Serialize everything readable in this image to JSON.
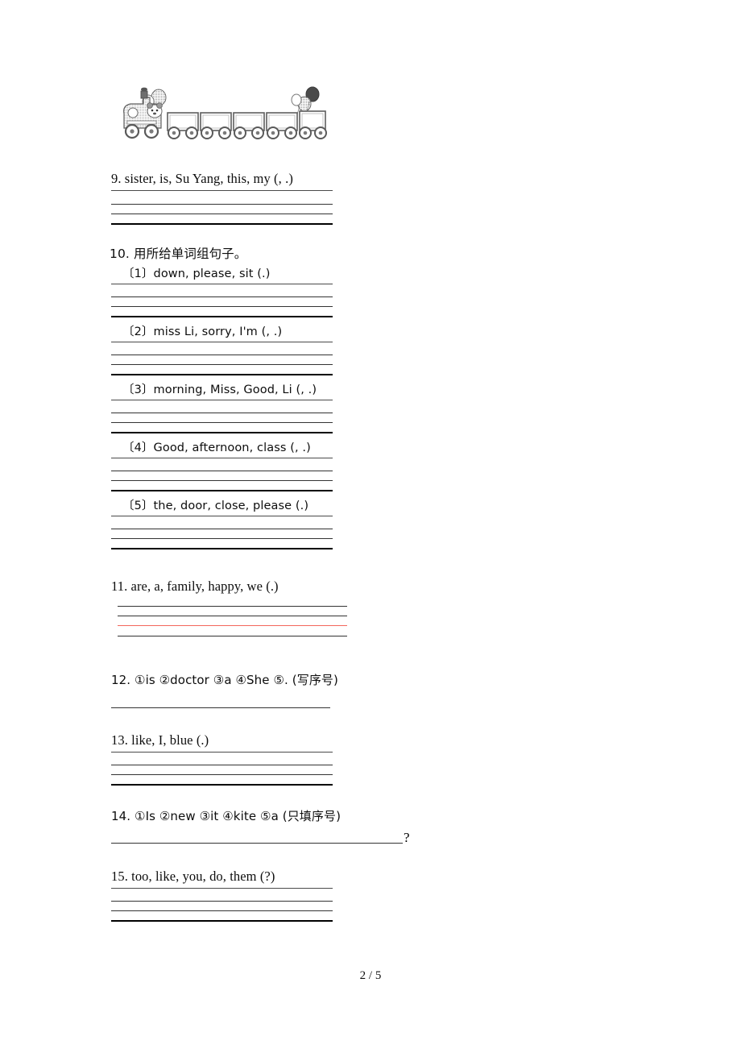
{
  "document": {
    "page_label": "2 / 5",
    "illustration": "train-clipart"
  },
  "questions": [
    {
      "id": "q9",
      "number": "9.",
      "prompt": "9. sister, is, Su Yang, this, my (, .)",
      "answer_lines": 4
    },
    {
      "id": "q10",
      "number": "10.",
      "prompt": "10. 用所给单词组句子。",
      "sub_items": [
        {
          "id": "q10-1",
          "label": "〔1〕",
          "prompt": "〔1〕down, please, sit (.)"
        },
        {
          "id": "q10-2",
          "label": "〔2〕",
          "prompt": "〔2〕miss Li, sorry, I'm (, .)"
        },
        {
          "id": "q10-3",
          "label": "〔3〕",
          "prompt": "〔3〕morning, Miss, Good, Li (, .)"
        },
        {
          "id": "q10-4",
          "label": "〔4〕",
          "prompt": "〔4〕Good, afternoon, class (, .)"
        },
        {
          "id": "q10-5",
          "label": "〔5〕",
          "prompt": "〔5〕the, door, close, please (.)"
        }
      ]
    },
    {
      "id": "q11",
      "number": "11.",
      "prompt": "11. are, a, family, happy, we (.)",
      "answer_lines": 4,
      "highlight_color": "#f4675c"
    },
    {
      "id": "q12",
      "number": "12.",
      "prompt": "12. ①is  ②doctor  ③a  ④She  ⑤. (写序号)",
      "answer_lines": 1
    },
    {
      "id": "q13",
      "number": "13.",
      "prompt": "13. like, I, blue (.)",
      "answer_lines": 4
    },
    {
      "id": "q14",
      "number": "14.",
      "prompt": "14. ①Is  ②new ③it ④kite ⑤a  (只填序号)",
      "answer_lines": 1,
      "trailing_punctuation": "?"
    },
    {
      "id": "q15",
      "number": "15.",
      "prompt": "15. too, like, you, do, them (?)",
      "answer_lines": 4
    }
  ]
}
